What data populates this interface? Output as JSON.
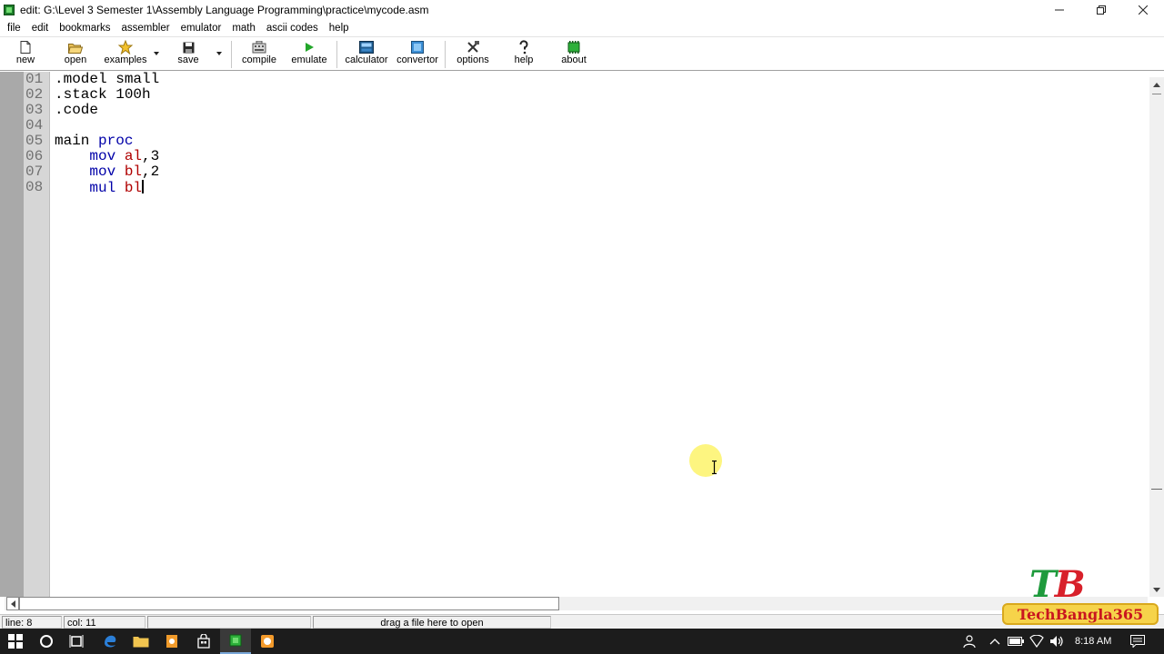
{
  "window": {
    "title": "edit: G:\\Level 3 Semester 1\\Assembly Language Programming\\practice\\mycode.asm",
    "controls": [
      "minimize",
      "restore",
      "close"
    ]
  },
  "menu": [
    "file",
    "edit",
    "bookmarks",
    "assembler",
    "emulator",
    "math",
    "ascii codes",
    "help"
  ],
  "toolbar": {
    "new": "new",
    "open": "open",
    "examples": "examples",
    "save": "save",
    "compile": "compile",
    "emulate": "emulate",
    "calculator": "calculator",
    "convertor": "convertor",
    "options": "options",
    "help": "help",
    "about": "about"
  },
  "editor": {
    "lines": [
      {
        "num": "01",
        "tokens": [
          {
            "t": ".model small",
            "c": "txt"
          }
        ]
      },
      {
        "num": "02",
        "tokens": [
          {
            "t": ".stack 100h",
            "c": "txt"
          }
        ]
      },
      {
        "num": "03",
        "tokens": [
          {
            "t": ".code",
            "c": "txt"
          }
        ]
      },
      {
        "num": "04",
        "tokens": []
      },
      {
        "num": "05",
        "tokens": [
          {
            "t": "main ",
            "c": "txt"
          },
          {
            "t": "proc",
            "c": "kw"
          }
        ]
      },
      {
        "num": "06",
        "tokens": [
          {
            "t": "    ",
            "c": "txt"
          },
          {
            "t": "mov",
            "c": "kw"
          },
          {
            "t": " ",
            "c": "txt"
          },
          {
            "t": "al",
            "c": "reg"
          },
          {
            "t": ",3",
            "c": "num"
          }
        ]
      },
      {
        "num": "07",
        "tokens": [
          {
            "t": "    ",
            "c": "txt"
          },
          {
            "t": "mov",
            "c": "kw"
          },
          {
            "t": " ",
            "c": "txt"
          },
          {
            "t": "bl",
            "c": "reg"
          },
          {
            "t": ",2",
            "c": "num"
          }
        ]
      },
      {
        "num": "08",
        "tokens": [
          {
            "t": "    ",
            "c": "txt"
          },
          {
            "t": "mul",
            "c": "kw"
          },
          {
            "t": " ",
            "c": "txt"
          },
          {
            "t": "bl",
            "c": "reg"
          }
        ]
      }
    ],
    "caret_line": 8
  },
  "status": {
    "line": "line: 8",
    "col": "col: 11",
    "hint": "drag a file here to open"
  },
  "watermark": {
    "letters_t": "T",
    "letters_b": "B",
    "banner": "TechBangla365"
  },
  "taskbar": {
    "time": "8:18 AM"
  },
  "colors": {
    "keyword": "#0000a8",
    "register": "#b00000",
    "gutter": "#d6d6d6",
    "taskbar": "#1c1c1c"
  }
}
